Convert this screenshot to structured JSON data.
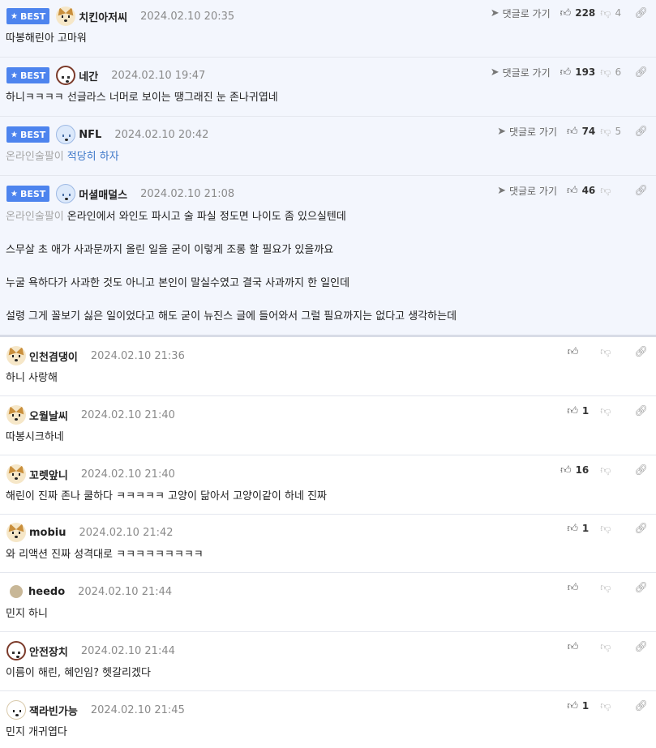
{
  "labels": {
    "best": "BEST",
    "reply": "댓글로 가기"
  },
  "comments": [
    {
      "best": true,
      "nick": "치킨아저씨",
      "date": "2024.02.10 20:35",
      "up": "228",
      "down": "4",
      "text": "따봉해린아 고마워"
    },
    {
      "best": true,
      "nick": "네간",
      "date": "2024.02.10 19:47",
      "up": "193",
      "down": "6",
      "text": "하니ㅋㅋㅋㅋ 선글라스 너머로 보이는 땡그래진 눈 존나귀엽네"
    },
    {
      "best": true,
      "nick": "NFL",
      "date": "2024.02.10 20:42",
      "up": "74",
      "down": "5",
      "mention": "온라인술팔이",
      "text": "적당히 하자"
    },
    {
      "best": true,
      "nick": "머셜매덜스",
      "date": "2024.02.10 21:08",
      "up": "46",
      "down": "",
      "mention": "온라인술팔이",
      "lines": [
        "온라인에서 와인도 파시고 술 파실 정도면 나이도 좀 있으실텐데",
        "스무살 초 애가 사과문까지 올린 일을 굳이 이렇게 조롱 할 필요가 있을까요",
        "누굴 욕하다가 사과한 것도 아니고 본인이 말실수였고 결국 사과까지 한 일인데",
        "설령 그게 꼴보기 싫은 일이었다고 해도 굳이 뉴진스 글에 들어와서 그럴 필요까지는 없다고 생각하는데"
      ]
    },
    {
      "best": false,
      "nick": "인천겸댕이",
      "date": "2024.02.10 21:36",
      "up": "",
      "down": "",
      "text": "하니 사랑해"
    },
    {
      "best": false,
      "nick": "오월날씨",
      "date": "2024.02.10 21:40",
      "up": "1",
      "down": "",
      "text": "따봉시크하네"
    },
    {
      "best": false,
      "nick": "꼬렛앞니",
      "date": "2024.02.10 21:40",
      "up": "16",
      "down": "",
      "text": "해린이 진짜 존나 쿨하다 ㅋㅋㅋㅋㅋ 고양이 닮아서 고양이같이 하네 진짜"
    },
    {
      "best": false,
      "nick": "mobiu",
      "date": "2024.02.10 21:42",
      "up": "1",
      "down": "",
      "text": "와 리액션 진짜 성격대로 ㅋㅋㅋㅋㅋㅋㅋㅋㅋ"
    },
    {
      "best": false,
      "nick": "heedo",
      "date": "2024.02.10 21:44",
      "up": "",
      "down": "",
      "text": "민지 하니"
    },
    {
      "best": false,
      "nick": "안전장치",
      "date": "2024.02.10 21:44",
      "up": "",
      "down": "",
      "text": "이름이 해린, 혜인임? 헷갈리겠다"
    },
    {
      "best": false,
      "nick": "잭라빈가능",
      "date": "2024.02.10 21:45",
      "up": "1",
      "down": "",
      "text": "민지 개귀엽다"
    }
  ],
  "icons": {
    "best_star": "star-icon",
    "reply_arrow": "arrow-icon",
    "upvote": "thumbs-up-icon",
    "downvote": "thumbs-down-icon",
    "link": "link-icon"
  }
}
